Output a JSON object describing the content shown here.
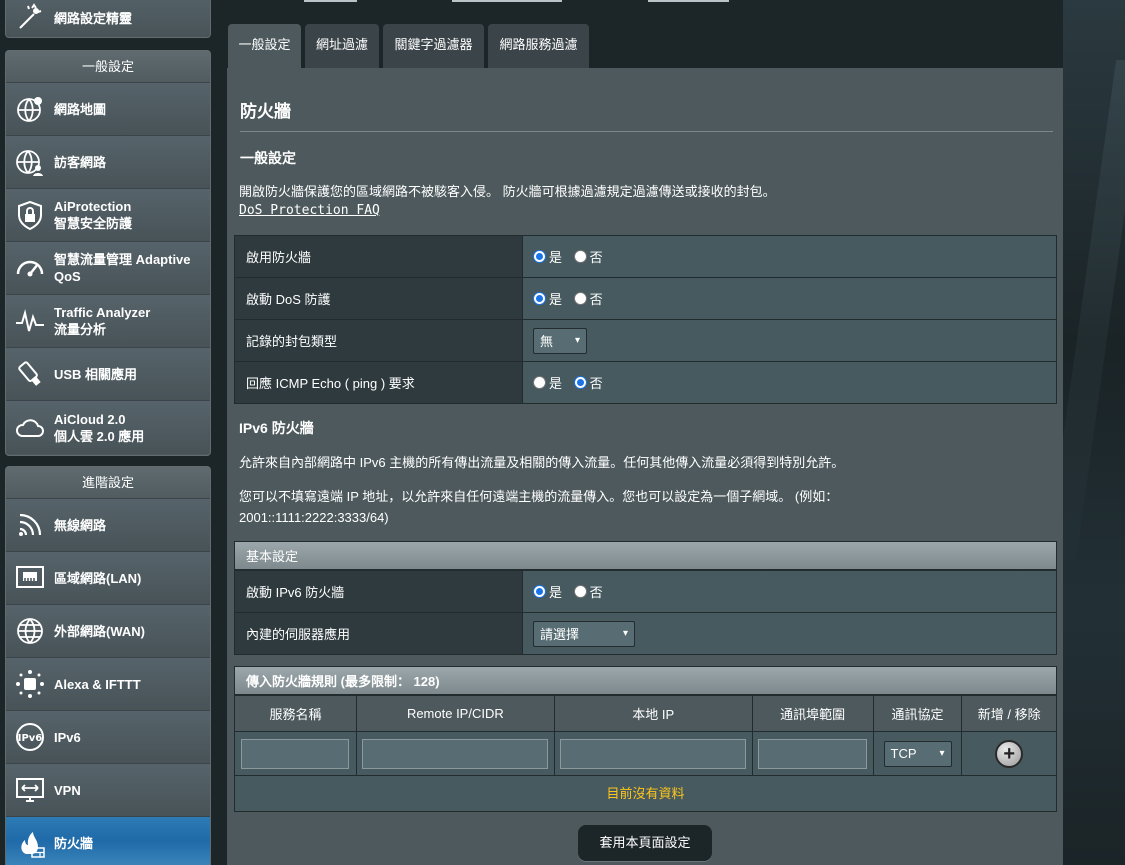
{
  "sidebar": {
    "top_item": {
      "label": "網路設定精靈",
      "icon": "wizard-icon"
    },
    "general": {
      "header": "一般設定",
      "items": [
        {
          "label": "網路地圖",
          "icon": "network-map-icon"
        },
        {
          "label": "訪客網路",
          "icon": "guest-network-icon"
        },
        {
          "label": "AiProtection",
          "label2": "智慧安全防護",
          "icon": "shield-lock-icon"
        },
        {
          "label": "智慧流量管理 Adaptive",
          "label2": "QoS",
          "icon": "speedometer-icon"
        },
        {
          "label": "Traffic Analyzer",
          "label2": "流量分析",
          "icon": "traffic-wave-icon"
        },
        {
          "label": "USB 相關應用",
          "icon": "usb-icon"
        },
        {
          "label": "AiCloud 2.0",
          "label2": "個人雲 2.0 應用",
          "icon": "cloud-icon"
        }
      ]
    },
    "advanced": {
      "header": "進階設定",
      "items": [
        {
          "label": "無線網路",
          "icon": "wireless-icon"
        },
        {
          "label": "區域網路(LAN)",
          "icon": "lan-icon"
        },
        {
          "label": "外部網路(WAN)",
          "icon": "wan-globe-icon"
        },
        {
          "label": "Alexa & IFTTT",
          "icon": "alexa-icon"
        },
        {
          "label": "IPv6",
          "icon": "ipv6-icon"
        },
        {
          "label": "VPN",
          "icon": "vpn-icon"
        },
        {
          "label": "防火牆",
          "icon": "firewall-icon"
        }
      ]
    }
  },
  "tabs": [
    "一般設定",
    "網址過濾",
    "關鍵字過濾器",
    "網路服務過濾"
  ],
  "page": {
    "title": "防火牆",
    "general_heading": "一般設定",
    "general_desc": "開啟防火牆保護您的區域網路不被駭客入侵。 防火牆可根據過濾規定過濾傳送或接收的封包。",
    "faq_link": "DoS Protection FAQ",
    "yes": "是",
    "no": "否",
    "settings": [
      {
        "label": "啟用防火牆",
        "value": "是"
      },
      {
        "label": "啟動 DoS 防護",
        "value": "是"
      },
      {
        "label": "記錄的封包類型",
        "value": "無"
      },
      {
        "label": "回應 ICMP Echo ( ping ) 要求",
        "value": "否"
      }
    ],
    "ipv6_heading": "IPv6 防火牆",
    "ipv6_desc1": "允許來自內部網路中 IPv6 主機的所有傳出流量及相關的傳入流量。任何其他傳入流量必須得到特別允許。",
    "ipv6_desc2": "您可以不填寫遠端 IP 地址，以允許來自任何遠端主機的流量傳入。您也可以設定為一個子網域。 (例如：",
    "ipv6_desc3": "2001::1111:2222:3333/64)",
    "basic_header": "基本設定",
    "basic": [
      {
        "label": "啟動 IPv6 防火牆",
        "value": "是"
      },
      {
        "label": "內建的伺服器應用",
        "value": "請選擇"
      }
    ],
    "rules_header": "傳入防火牆規則 (最多限制： 128)",
    "rules_columns": [
      "服務名稱",
      "Remote IP/CIDR",
      "本地 IP",
      "通訊埠範圍",
      "通訊協定",
      "新增 / 移除"
    ],
    "protocol_value": "TCP",
    "empty_text": "目前沒有資料",
    "apply_button": "套用本頁面設定"
  },
  "colors": {
    "panel": "#4d595d",
    "label_cell": "#2f3a3e",
    "empty_text": "#ffc61a",
    "active_menu": "#2d7bb5"
  }
}
